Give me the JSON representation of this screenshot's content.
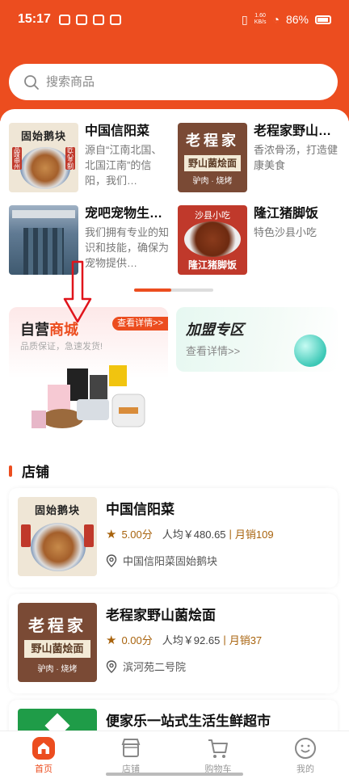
{
  "status_bar": {
    "time": "15:17",
    "net_speed_value": "1.60",
    "net_speed_unit": "KB/s",
    "battery": "86%"
  },
  "search": {
    "placeholder": "搜索商品"
  },
  "recommendations": [
    {
      "title": "中国信阳菜",
      "desc": "源自“江南北国、北国江南”的信阳，我们…",
      "thumb": {
        "name": "固始鹅块",
        "left_seal": "品味申州",
        "right_seal": "匠心烹制"
      }
    },
    {
      "title": "老程家野山…",
      "desc": "香浓骨汤，打造健康美食",
      "thumb": {
        "big": "老程家",
        "band": "野山菌烩面",
        "small": "驴肉 · 烧烤"
      }
    },
    {
      "title": "宠吧宠物生…",
      "desc": "我们拥有专业的知识和技能，确保为宠物提供…",
      "thumb": {}
    },
    {
      "title": "隆江猪脚饭",
      "desc": "特色沙县小吃",
      "thumb": {
        "top": "沙县小吃",
        "bottom": "隆江猪脚饭"
      }
    }
  ],
  "promos": {
    "own": {
      "title_a": "自营",
      "title_b": "商城",
      "sub": "品质保证，急速发货!",
      "button": "查看详情>>"
    },
    "join": {
      "title": "加盟专区",
      "sub": "查看详情>>"
    }
  },
  "shops_section": {
    "title": "店铺"
  },
  "shops": [
    {
      "name": "中国信阳菜",
      "score": "5.00分",
      "avg": "人均￥480.65",
      "sep": "|",
      "sales": "月销109",
      "addr": "中国信阳菜固始鹅块"
    },
    {
      "name": "老程家野山菌烩面",
      "score": "0.00分",
      "avg": "人均￥92.65",
      "sep": "|",
      "sales": "月销37",
      "addr": "滨河苑二号院"
    },
    {
      "name": "便家乐一站式生活生鲜超市"
    }
  ],
  "nav": [
    {
      "label": "首页",
      "icon": "home-icon",
      "active": true
    },
    {
      "label": "店铺",
      "icon": "store-icon"
    },
    {
      "label": "购物车",
      "icon": "cart-icon"
    },
    {
      "label": "我的",
      "icon": "smile-icon"
    }
  ],
  "colors": {
    "brand": "#ec4d1f",
    "rating": "#a8630d"
  }
}
